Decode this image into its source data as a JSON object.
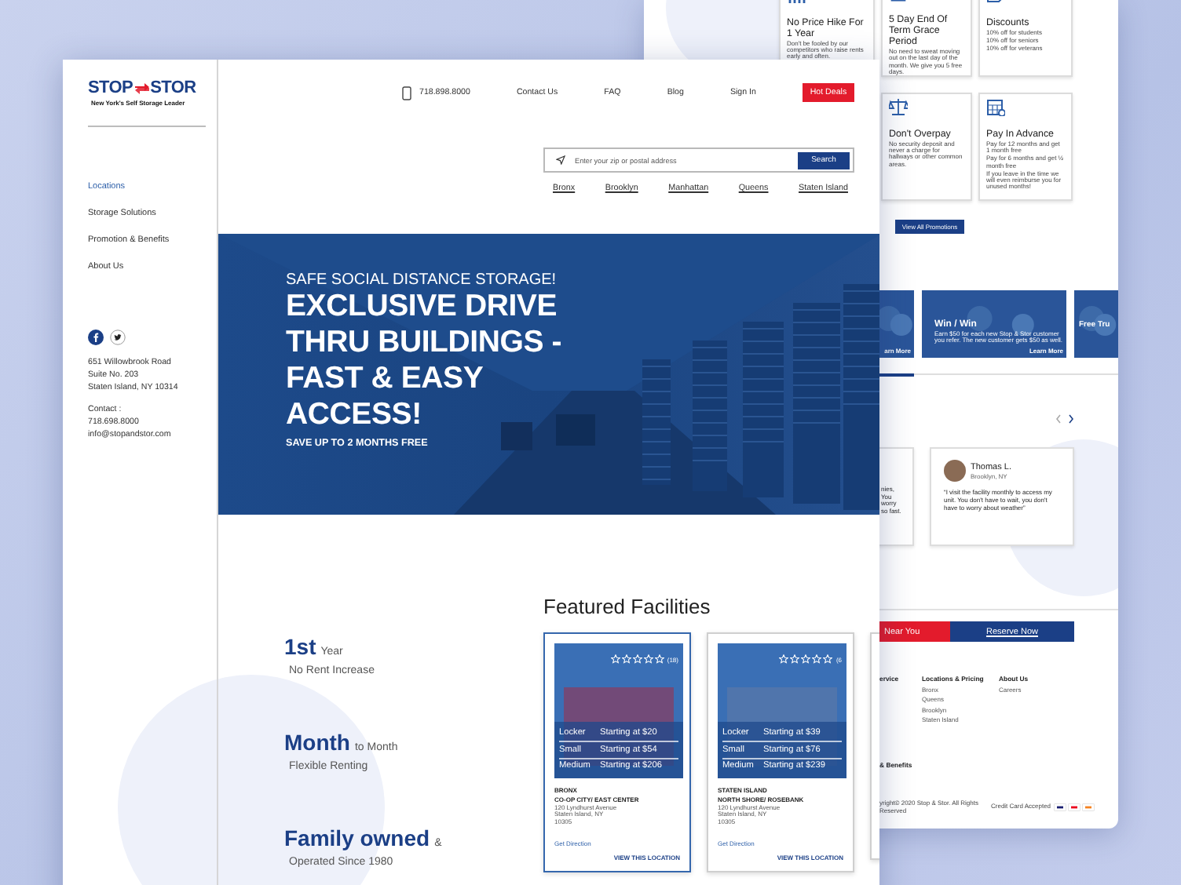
{
  "back_page": {
    "promotions": [
      {
        "title": "No Price Hike For 1 Year",
        "lines": [
          "Don't be fooled by our competitors who raise rents early and often."
        ]
      },
      {
        "title": "5 Day End Of Term Grace Period",
        "lines": [
          "No need to sweat moving out on the last day of the month. We give you 5 free days."
        ]
      },
      {
        "title": "Discounts",
        "lines": [
          "10% off for students",
          "10% off for seniors",
          "10% off for veterans"
        ]
      },
      {
        "title": "Don't Overpay",
        "lines": [
          "No security deposit and never a charge for hallways or other common areas."
        ]
      },
      {
        "title": "Pay In Advance",
        "lines": [
          "Pay for 12 months and get 1 month free",
          "Pay for 6 months and get ½ month free",
          "If you leave in the time we will even reimburse you for unused months!"
        ]
      }
    ],
    "promotions_button": "View All Promotions",
    "banners": [
      {
        "link": "arn More"
      },
      {
        "title": "Win / Win",
        "text": "Earn $50 for each new Stop & Stor customer you refer. The new customer gets $50 as well.",
        "link": "Learn More"
      },
      {
        "title": "Free Tru"
      }
    ],
    "testimonials": [
      {
        "kind": "fragment",
        "lines": [
          "nies,",
          "You",
          "worry",
          "so fast."
        ]
      },
      {
        "kind": "review",
        "name": "Thomas L.",
        "place": "Brooklyn, NY",
        "quote": "“I visit the facility monthly to access my unit. You don't have to wait, you don't have to worry about weather”"
      }
    ],
    "actions": [
      {
        "label": "Near You",
        "kind": "primary"
      },
      {
        "label": "Reserve Now",
        "kind": "secondary"
      }
    ],
    "footer": {
      "columns": [
        {
          "title": "ervice"
        },
        {
          "title": "Locations & Pricing",
          "links": [
            "Bronx",
            "Queens",
            "Brooklyn",
            "Staten Island"
          ]
        },
        {
          "title": "About Us",
          "links": [
            "Careers"
          ]
        }
      ],
      "heading": "& Benefits",
      "copyright": "yright© 2020 Stop & Stor. All Rights Reserved",
      "cards_label": "Credit Card Accepted"
    }
  },
  "front_page": {
    "logo": {
      "left": "STOP",
      "right": "STOR",
      "tagline": "New York's Self Storage Leader"
    },
    "nav": [
      {
        "label": "Locations",
        "selected": true
      },
      {
        "label": "Storage Solutions",
        "selected": false
      },
      {
        "label": "Promotion & Benefits",
        "selected": false
      },
      {
        "label": "About Us",
        "selected": false
      }
    ],
    "address": [
      "651 Willowbrook Road",
      "Suite No. 203",
      "Staten Island, NY 10314"
    ],
    "contact": {
      "label": "Contact :",
      "phone": "718.698.8000",
      "email": "info@stopandstor.com"
    },
    "header": {
      "phone": "718.898.8000",
      "links": [
        "Contact Us",
        "FAQ",
        "Blog",
        "Sign In"
      ],
      "hot_deals": "Hot Deals"
    },
    "search": {
      "placeholder": "Enter your zip or postal address",
      "button": "Search"
    },
    "boroughs": [
      "Bronx",
      "Brooklyn",
      "Manhattan",
      "Queens",
      "Staten Island"
    ],
    "hero": {
      "eyebrow": "SAFE SOCIAL DISTANCE STORAGE!",
      "headline": [
        "EXCLUSIVE DRIVE",
        "THRU BUILDINGS -",
        "FAST & EASY",
        "ACCESS!"
      ],
      "subline": "SAVE UP TO 2 MONTHS FREE"
    },
    "stats": [
      {
        "big": "1st",
        "small": "Year",
        "sub": "No Rent Increase"
      },
      {
        "big": "Month",
        "small": "to Month",
        "sub": "Flexible Renting"
      },
      {
        "big": "Family owned",
        "small": "&",
        "sub": "Operated Since 1980"
      }
    ],
    "featured": {
      "title": "Featured Facilities",
      "facilities": [
        {
          "selected": true,
          "stars": 0,
          "rating_count": "(18)",
          "prices": [
            {
              "size": "Locker",
              "price": "Starting at $20"
            },
            {
              "size": "Small",
              "price": "Starting at $54"
            },
            {
              "size": "Medium",
              "price": "Starting at $206"
            }
          ],
          "borough": "BRONX",
          "area": "CO-OP CITY/ EAST CENTER",
          "address": [
            "120 Lyndhurst Avenue",
            "Staten Island, NY",
            "10305"
          ],
          "direction": "Get Direction",
          "link": "VIEW THIS LOCATION"
        },
        {
          "selected": false,
          "stars": 0,
          "rating_count": "(6",
          "prices": [
            {
              "size": "Locker",
              "price": "Starting at $39"
            },
            {
              "size": "Small",
              "price": "Starting at $76"
            },
            {
              "size": "Medium",
              "price": "Starting at $239"
            }
          ],
          "borough": "STATEN ISLAND",
          "area": "NORTH SHORE/ ROSEBANK",
          "address": [
            "120 Lyndhurst Avenue",
            "Staten Island, NY",
            "10305"
          ],
          "direction": "Get Direction",
          "link": "VIEW THIS LOCATION"
        },
        {
          "selected": false
        }
      ]
    }
  }
}
